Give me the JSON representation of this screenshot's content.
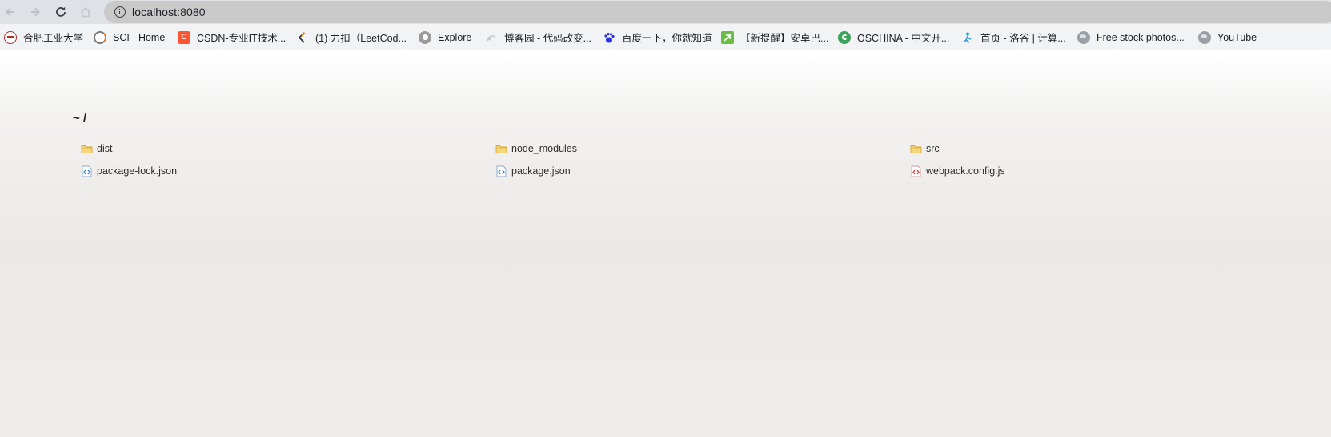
{
  "browser": {
    "back_icon": "back-arrow-icon",
    "forward_icon": "forward-arrow-icon",
    "reload_icon": "reload-icon",
    "home_icon": "home-icon",
    "address_bar": {
      "info_icon": "info-icon",
      "url": "localhost:8080"
    }
  },
  "bookmarks": [
    {
      "label": "合肥工业大学",
      "icon": "hfut-icon",
      "color": "#b52c2c"
    },
    {
      "label": "SCI - Home",
      "icon": "sci-icon",
      "color": "#e0791b"
    },
    {
      "label": "CSDN-专业IT技术...",
      "icon": "csdn-icon",
      "color": "#fc5531"
    },
    {
      "label": "(1) 力扣（LeetCod...",
      "icon": "leetcode-icon",
      "color": "#f89f1b"
    },
    {
      "label": "Explore",
      "icon": "github-icon",
      "color": "#9b9b9b"
    },
    {
      "label": "博客园 - 代码改变...",
      "icon": "cnblogs-icon",
      "color": "#c8c8c8"
    },
    {
      "label": "百度一下，你就知道",
      "icon": "baidu-icon",
      "color": "#2932e1"
    },
    {
      "label": "【新提醒】安卓巴...",
      "icon": "anzhuoba-icon",
      "color": "#6cbd45"
    },
    {
      "label": "OSCHINA - 中文开...",
      "icon": "oschina-icon",
      "color": "#3aa45a"
    },
    {
      "label": "首页 - 洛谷 | 计算...",
      "icon": "luogu-icon",
      "color": "#3498db"
    },
    {
      "label": "Free stock photos...",
      "icon": "globe-icon",
      "color": "#9aa0a6"
    },
    {
      "label": "YouTube",
      "icon": "globe-icon",
      "color": "#9aa0a6"
    }
  ],
  "listing": {
    "breadcrumb": "~ /",
    "items": [
      {
        "name": "dist",
        "type": "folder"
      },
      {
        "name": "node_modules",
        "type": "folder"
      },
      {
        "name": "src",
        "type": "folder"
      },
      {
        "name": "package-lock.json",
        "type": "json"
      },
      {
        "name": "package.json",
        "type": "json"
      },
      {
        "name": "webpack.config.js",
        "type": "js"
      }
    ]
  }
}
